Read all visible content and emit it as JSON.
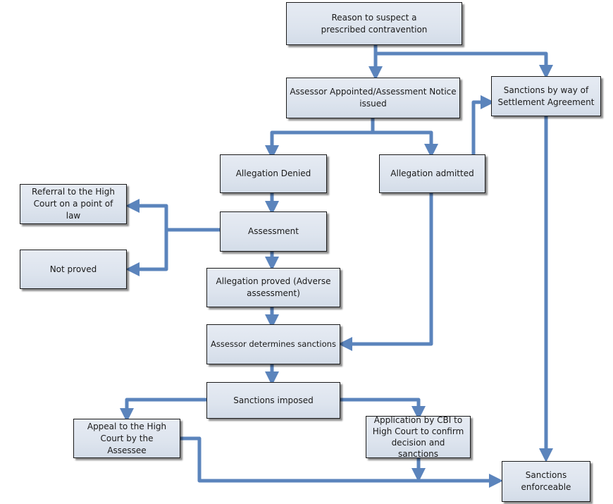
{
  "diagram": {
    "title": "",
    "colors": {
      "connector": "#5b84bc",
      "node_fill": "#dde4ee",
      "node_border": "#1a1a1a"
    },
    "nodes": {
      "reason": "Reason to suspect a prescribed contravention",
      "assessor_appointed": "Assessor Appointed/Assessment Notice issued",
      "settlement": "Sanctions by way of Settlement Agreement",
      "denied": "Allegation Denied",
      "admitted": "Allegation admitted",
      "referral": "Referral to the High Court on a point of law",
      "assessment": "Assessment",
      "not_proved": "Not proved",
      "proved": "Allegation proved (Adverse assessment)",
      "determines": "Assessor determines sanctions",
      "imposed": "Sanctions imposed",
      "appeal": "Appeal to the High Court by the Assessee",
      "application": "Application by CBI to High Court to confirm decision and sanctions",
      "enforceable": "Sanctions enforceable"
    },
    "edges": [
      {
        "from": "reason",
        "to": "assessor_appointed"
      },
      {
        "from": "reason",
        "to": "settlement"
      },
      {
        "from": "assessor_appointed",
        "to": "denied"
      },
      {
        "from": "assessor_appointed",
        "to": "admitted"
      },
      {
        "from": "admitted",
        "to": "settlement"
      },
      {
        "from": "settlement",
        "to": "enforceable"
      },
      {
        "from": "denied",
        "to": "assessment"
      },
      {
        "from": "assessment",
        "to": "referral"
      },
      {
        "from": "assessment",
        "to": "not_proved"
      },
      {
        "from": "assessment",
        "to": "proved"
      },
      {
        "from": "proved",
        "to": "determines"
      },
      {
        "from": "admitted",
        "to": "determines"
      },
      {
        "from": "determines",
        "to": "imposed"
      },
      {
        "from": "imposed",
        "to": "appeal"
      },
      {
        "from": "imposed",
        "to": "application"
      },
      {
        "from": "application",
        "to": "enforceable"
      },
      {
        "from": "appeal",
        "to": "enforceable"
      }
    ]
  }
}
